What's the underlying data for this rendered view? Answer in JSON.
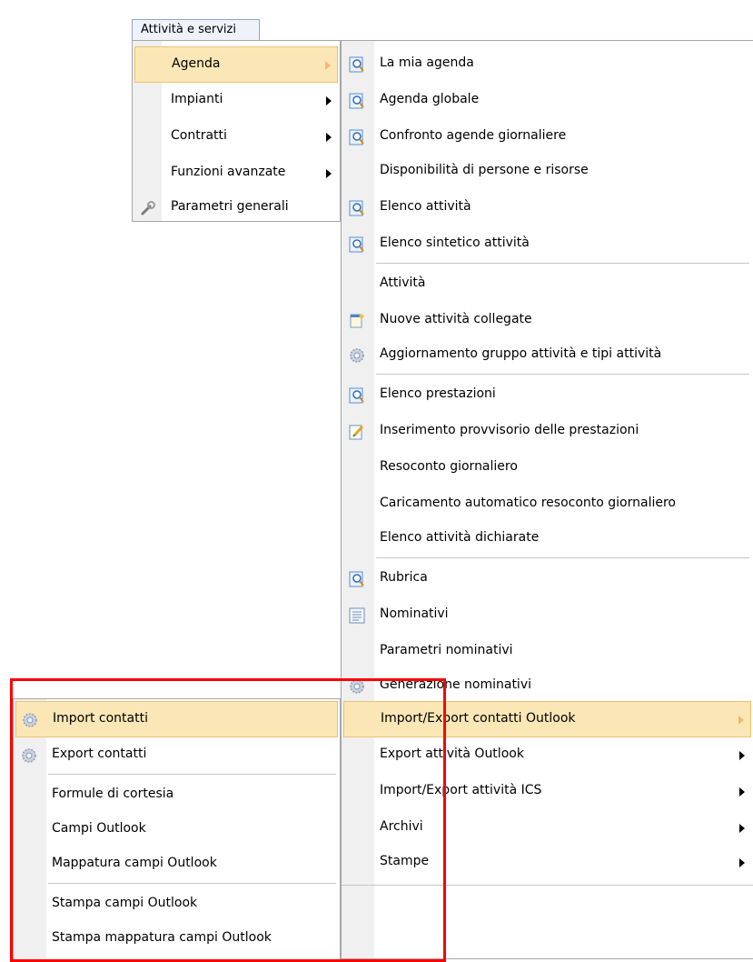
{
  "menubar": {
    "title": "Attività e servizi"
  },
  "menu1": {
    "items": [
      {
        "label": "Agenda"
      },
      {
        "label": "Impianti"
      },
      {
        "label": "Contratti"
      },
      {
        "label": "Funzioni avanzate"
      },
      {
        "label": "Parametri generali"
      }
    ]
  },
  "menu2": {
    "items": [
      {
        "label": "La mia agenda"
      },
      {
        "label": "Agenda globale"
      },
      {
        "label": "Confronto agende giornaliere"
      },
      {
        "label": "Disponibilità di persone e risorse"
      },
      {
        "label": "Elenco attività"
      },
      {
        "label": "Elenco sintetico attività"
      },
      {
        "label": "Attività"
      },
      {
        "label": "Nuove attività collegate"
      },
      {
        "label": "Aggiornamento gruppo attività e tipi attività"
      },
      {
        "label": "Elenco prestazioni"
      },
      {
        "label": "Inserimento provvisorio delle prestazioni"
      },
      {
        "label": "Resoconto giornaliero"
      },
      {
        "label": "Caricamento automatico resoconto giornaliero"
      },
      {
        "label": "Elenco attività dichiarate"
      },
      {
        "label": "Rubrica"
      },
      {
        "label": "Nominativi"
      },
      {
        "label": "Parametri nominativi"
      },
      {
        "label": "Generazione nominativi"
      },
      {
        "label": "Import/Export contatti Outlook"
      },
      {
        "label": "Export attività Outlook"
      },
      {
        "label": "Import/Export attività ICS"
      },
      {
        "label": "Archivi"
      },
      {
        "label": "Stampe"
      }
    ]
  },
  "menu3": {
    "items": [
      {
        "label": "Import contatti"
      },
      {
        "label": "Export contatti"
      },
      {
        "label": "Formule di cortesia"
      },
      {
        "label": "Campi Outlook"
      },
      {
        "label": "Mappatura campi Outlook"
      },
      {
        "label": "Stampa campi Outlook"
      },
      {
        "label": "Stampa mappatura campi Outlook"
      }
    ]
  },
  "colors": {
    "highlight": "#fbe7b6",
    "highlight_border": "#e9c374",
    "annotation": "#ff0000"
  }
}
